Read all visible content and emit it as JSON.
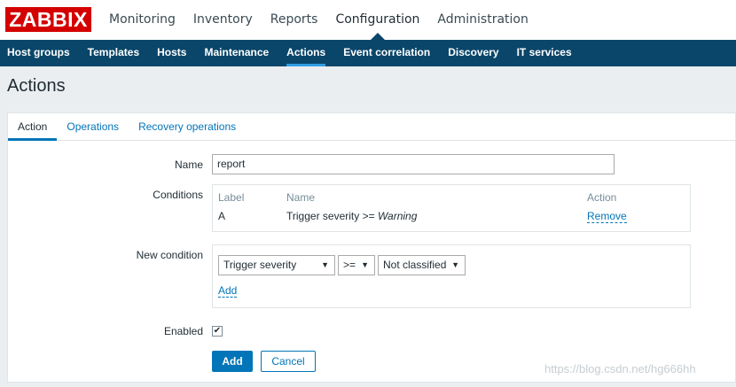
{
  "brand": {
    "logo_text": "ZABBIX",
    "logo_color": "#d40000"
  },
  "main_menu": [
    {
      "label": "Monitoring"
    },
    {
      "label": "Inventory"
    },
    {
      "label": "Reports"
    },
    {
      "label": "Configuration",
      "active": true
    },
    {
      "label": "Administration"
    }
  ],
  "sub_menu": [
    {
      "label": "Host groups"
    },
    {
      "label": "Templates"
    },
    {
      "label": "Hosts"
    },
    {
      "label": "Maintenance"
    },
    {
      "label": "Actions",
      "active": true
    },
    {
      "label": "Event correlation"
    },
    {
      "label": "Discovery"
    },
    {
      "label": "IT services"
    }
  ],
  "page": {
    "title": "Actions"
  },
  "tabs": [
    {
      "label": "Action",
      "active": true
    },
    {
      "label": "Operations"
    },
    {
      "label": "Recovery operations"
    }
  ],
  "form": {
    "name_label": "Name",
    "name_value": "report",
    "conditions_label": "Conditions",
    "conditions_table": {
      "headers": {
        "label": "Label",
        "name": "Name",
        "action": "Action"
      },
      "rows": [
        {
          "label": "A",
          "name_prefix": "Trigger severity >= ",
          "name_value": "Warning",
          "action": "Remove"
        }
      ]
    },
    "new_condition_label": "New condition",
    "new_condition": {
      "type_selected": "Trigger severity",
      "operator_selected": ">=",
      "value_selected": "Not classified",
      "add_link": "Add"
    },
    "enabled_label": "Enabled",
    "enabled_checked": true,
    "enabled_mark": "✔",
    "add_button": "Add",
    "cancel_button": "Cancel"
  },
  "watermark": "https://blog.csdn.net/hg666hh",
  "colors": {
    "nav_bg": "#0a466a",
    "accent": "#0275b8",
    "active_underline": "#2e9ee3"
  },
  "icons": {
    "select_arrow": "▼"
  }
}
